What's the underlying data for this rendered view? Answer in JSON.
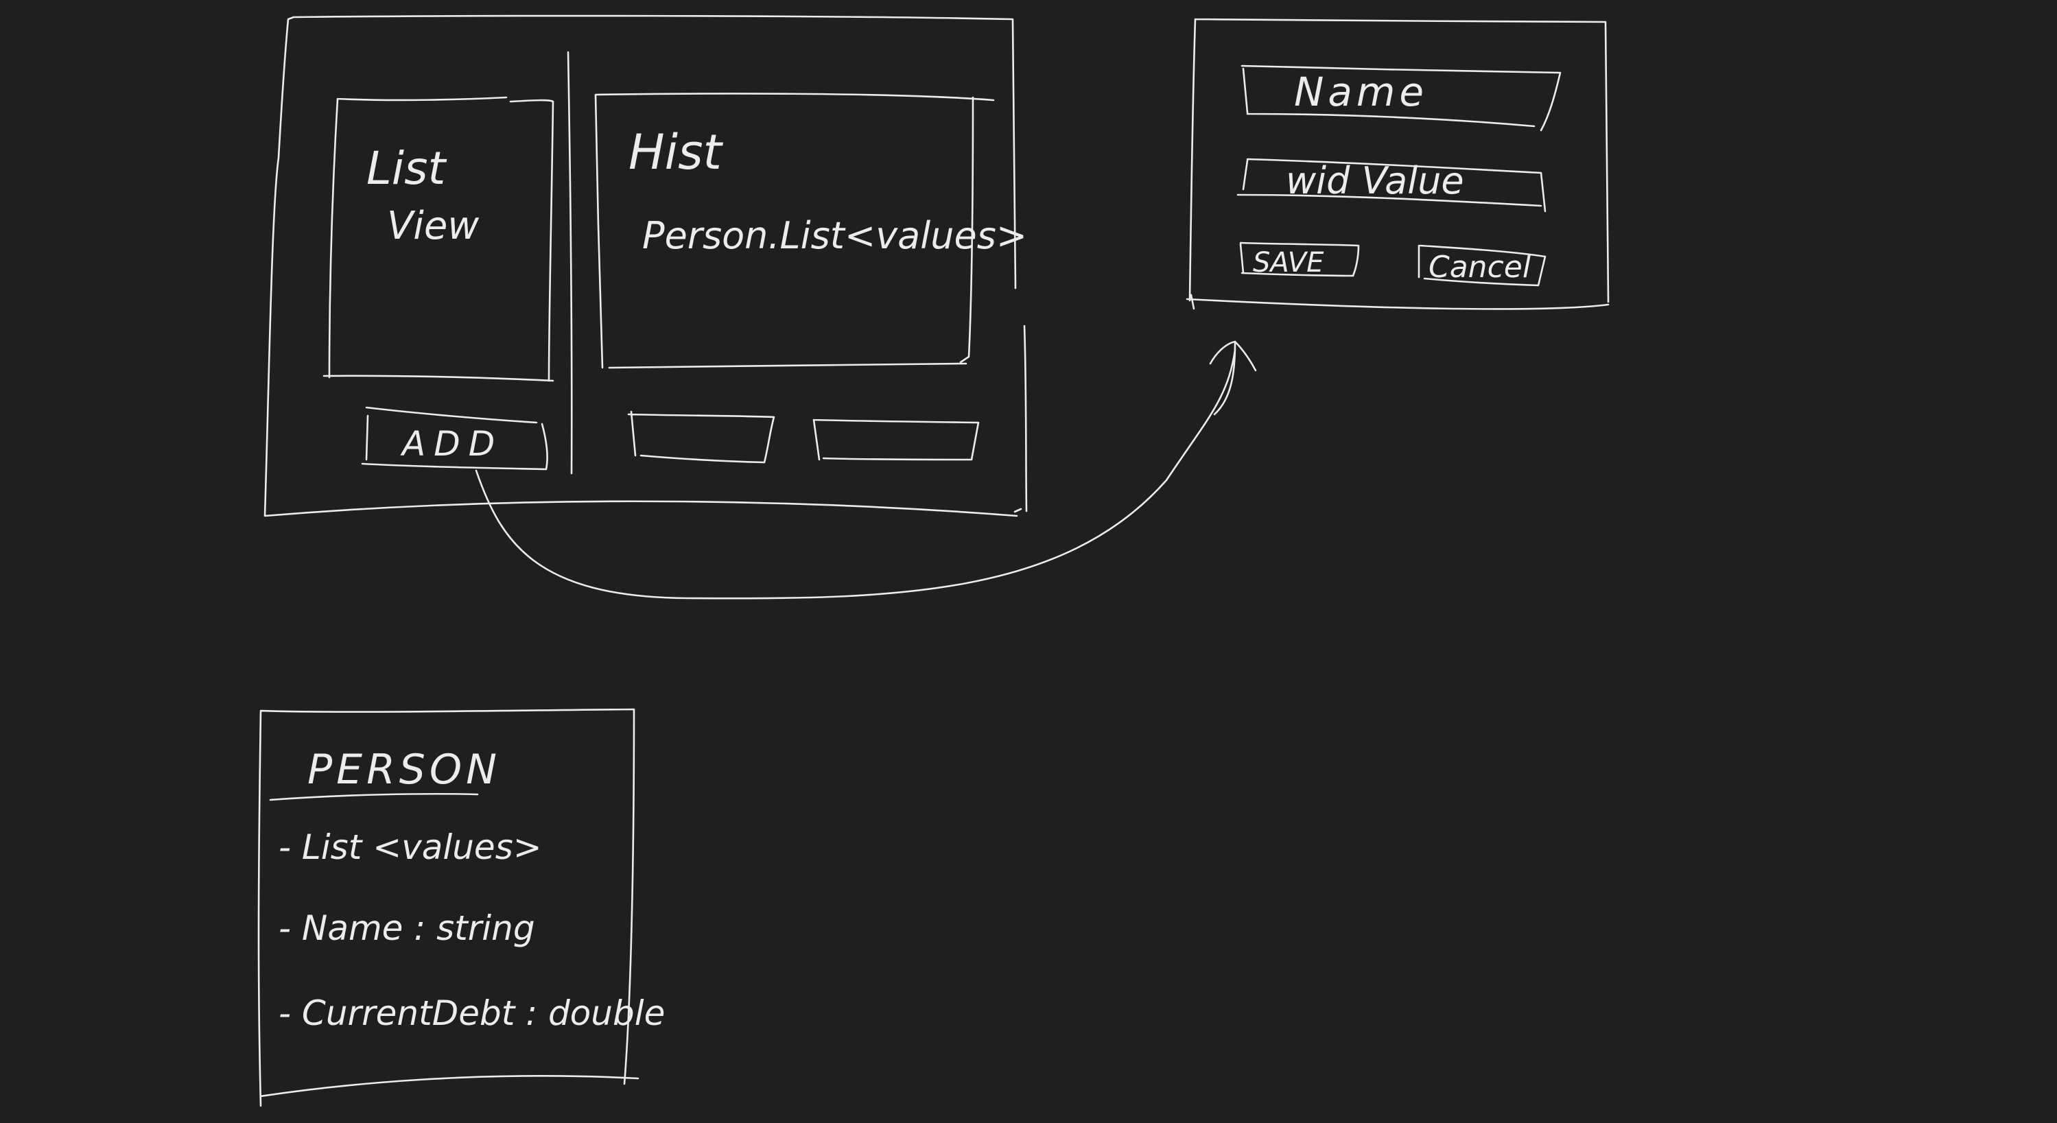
{
  "colors": {
    "background": "#1f1f1f",
    "ink": "#ececec"
  },
  "main_window": {
    "list_view_panel": {
      "line1": "List",
      "line2": "View"
    },
    "hist_panel": {
      "title": "Hist",
      "body": "Person.List<values>"
    },
    "add_button": {
      "label": "ADD"
    }
  },
  "dialog": {
    "name_field": {
      "label": "Name"
    },
    "value_field": {
      "label": "wid Value"
    },
    "save_button": {
      "label": "SAVE"
    },
    "cancel_button": {
      "label": "Cancel"
    }
  },
  "person_class": {
    "title": "PERSON",
    "fields": [
      "- List <values>",
      "- Name : string",
      "- CurrentDebt : double"
    ]
  },
  "connector": {
    "from": "add_button",
    "to": "dialog",
    "style": "curved-arrow"
  }
}
